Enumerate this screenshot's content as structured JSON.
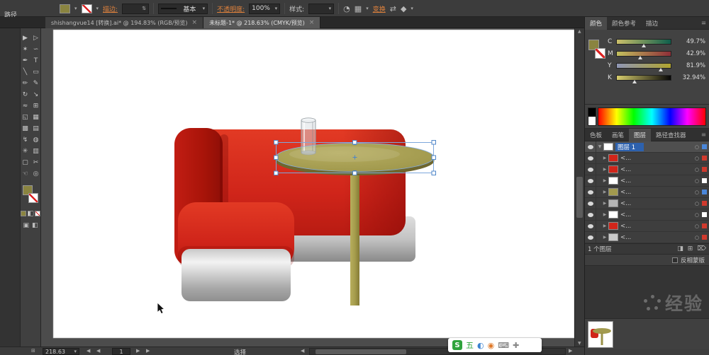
{
  "colors": {
    "fill_swatch": "#8a8440",
    "sofa_red": "#d0251a",
    "table_olive": "#a29a4e",
    "accent_blue": "#2d61ad",
    "link_orange": "#e0823c"
  },
  "icons": {
    "caret_down": "▾",
    "stepper": "⇅",
    "close": "×",
    "menu": "≡",
    "recolor": "◔",
    "align": "▦",
    "shuffle": "⇄",
    "settings": "◆",
    "expand_open": "▼",
    "expand_closed": "▶",
    "target": "○",
    "clip_mask": "◨",
    "new_layer": "⊞",
    "delete": "⌦",
    "prev": "◀",
    "next": "▶",
    "up": "▲",
    "down": "▼",
    "grid": "⊞",
    "screen_mode": "◧",
    "draw_mode": "▣"
  },
  "topbar": {
    "selection_type": "路径",
    "stroke_label": "描边:",
    "stroke_width": "",
    "brush_value": "基本",
    "opacity_label": "不透明度:",
    "opacity_value": "100%",
    "style_label": "样式:",
    "style_value": "",
    "transform_label": "变换"
  },
  "tabs": [
    {
      "label": "shishangvue14 [转换].ai* @ 194.83% (RGB/预览)"
    },
    {
      "label": "未标题-1* @ 218.63% (CMYK/预览)"
    }
  ],
  "tools": [
    {
      "name": "selection-tool",
      "glyph": "▶"
    },
    {
      "name": "direct-selection-tool",
      "glyph": "▷"
    },
    {
      "name": "magic-wand-tool",
      "glyph": "✶"
    },
    {
      "name": "lasso-tool",
      "glyph": "∽"
    },
    {
      "name": "pen-tool",
      "glyph": "✒"
    },
    {
      "name": "type-tool",
      "glyph": "T"
    },
    {
      "name": "line-segment-tool",
      "glyph": "╲"
    },
    {
      "name": "rectangle-tool",
      "glyph": "▭"
    },
    {
      "name": "paintbrush-tool",
      "glyph": "✏"
    },
    {
      "name": "pencil-tool",
      "glyph": "✎"
    },
    {
      "name": "rotate-tool",
      "glyph": "↻"
    },
    {
      "name": "scale-tool",
      "glyph": "↘"
    },
    {
      "name": "width-tool",
      "glyph": "≈"
    },
    {
      "name": "free-transform-tool",
      "glyph": "⊞"
    },
    {
      "name": "shape-builder-tool",
      "glyph": "◱"
    },
    {
      "name": "perspective-grid-tool",
      "glyph": "▦"
    },
    {
      "name": "mesh-tool",
      "glyph": "▩"
    },
    {
      "name": "gradient-tool",
      "glyph": "▤"
    },
    {
      "name": "eyedropper-tool",
      "glyph": "↯"
    },
    {
      "name": "blend-tool",
      "glyph": "◍"
    },
    {
      "name": "symbol-sprayer-tool",
      "glyph": "✳"
    },
    {
      "name": "column-graph-tool",
      "glyph": "▥"
    },
    {
      "name": "artboard-tool",
      "glyph": "▢"
    },
    {
      "name": "slice-tool",
      "glyph": "✂"
    },
    {
      "name": "hand-tool",
      "glyph": "☜"
    },
    {
      "name": "zoom-tool",
      "glyph": "◎"
    }
  ],
  "right": {
    "color_tabs": [
      "颜色",
      "颜色参考",
      "描边"
    ],
    "channels": [
      {
        "label": "C",
        "value": "49.7%"
      },
      {
        "label": "M",
        "value": "42.9%"
      },
      {
        "label": "Y",
        "value": "81.9%"
      },
      {
        "label": "K",
        "value": "32.94%"
      }
    ],
    "panel_tabs": [
      "色板",
      "画笔",
      "图层",
      "路径查找器"
    ],
    "layers": {
      "parent": {
        "label": "图层 1",
        "chip": "#4a86d8"
      },
      "children": [
        {
          "label": "<...",
          "thumb": "#d0251a",
          "chip": "#d03a2e"
        },
        {
          "label": "<...",
          "thumb": "#d0251a",
          "chip": "#d03a2e"
        },
        {
          "label": "<...",
          "thumb": "#ffffff",
          "chip": "#ffffff"
        },
        {
          "label": "<...",
          "thumb": "#a29a4e",
          "chip": "#4a86d8"
        },
        {
          "label": "<...",
          "thumb": "#b5b5b5",
          "chip": "#d03a2e"
        },
        {
          "label": "<...",
          "thumb": "#ffffff",
          "chip": "#ffffff"
        },
        {
          "label": "<...",
          "thumb": "#d0251a",
          "chip": "#d03a2e"
        },
        {
          "label": "<...",
          "thumb": "#c9c9c9",
          "chip": "#d03a2e"
        }
      ],
      "footer": "1 个图层"
    },
    "invert_mask": "反相蒙版"
  },
  "statusbar": {
    "zoom": "218.63",
    "page": "1",
    "status": "选择"
  },
  "ime": {
    "items": [
      {
        "name": "sogou-logo-icon",
        "glyph": "S",
        "color": "#ffffff"
      },
      {
        "name": "wubi-icon",
        "glyph": "五",
        "color": "#2fa33c"
      },
      {
        "name": "night-mode-icon",
        "glyph": "◐",
        "color": "#3b82d0"
      },
      {
        "name": "skin-icon",
        "glyph": "◉",
        "color": "#e07a2a"
      },
      {
        "name": "keyboard-icon",
        "glyph": "⌨",
        "color": "#666666"
      },
      {
        "name": "toolbox-icon",
        "glyph": "✚",
        "color": "#888888"
      }
    ]
  },
  "watermark": "经验"
}
